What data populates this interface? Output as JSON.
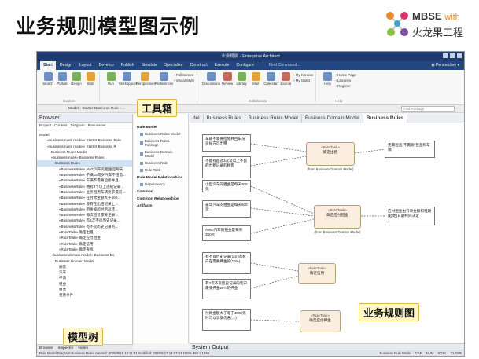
{
  "slide": {
    "title": "业务规则模型图示例",
    "logo_line1": "MBSE",
    "logo_with": "with",
    "logo_line2": "火龙果工程"
  },
  "window": {
    "title": "业务规则 - Enterprise Architect"
  },
  "menu": {
    "items": [
      "Start",
      "Design",
      "Layout",
      "Develop",
      "Publish",
      "Simulate",
      "Specialize",
      "Construct",
      "Execute",
      "Configure",
      "Find Command..."
    ],
    "active": "Start",
    "perspective": "Perspective"
  },
  "ribbon": {
    "groups": [
      {
        "label": "Explore",
        "buttons": [
          "Search",
          "Portals",
          "Design",
          "Start"
        ]
      },
      {
        "label": "Desktop",
        "buttons": [
          "Run",
          "Workspaces",
          "Perspectives",
          "Preferences"
        ],
        "small": [
          "Full Screen",
          "Visual Style"
        ]
      },
      {
        "label": "Collaborate",
        "buttons": [
          "Discussions",
          "Review",
          "Library",
          "Mail",
          "Calendar",
          "Journal"
        ],
        "small": [
          "My Kanban",
          "My Gantt"
        ]
      },
      {
        "label": "Help",
        "buttons": [
          "Help"
        ],
        "small": [
          "Home Page",
          "Libraries",
          "Register"
        ]
      }
    ]
  },
  "address": {
    "path": "Model  ›  Starter Business Rule  ›  ...",
    "find_placeholder": "Find Package"
  },
  "browser": {
    "title": "Browser",
    "tabs": [
      "Project",
      "Context",
      "Diagram",
      "Resources"
    ],
    "tree": [
      "Model",
      "«business rules model» Starter Business Rule",
      "«business rules model» Starter Business R",
      "Business Rules Model",
      "«business rules» Business Rules",
      "Business Rules",
      "«BusinessRule» AWD汽车的租金是每天...",
      "«BusinessRule» 不满18周岁汽车不租借...",
      "«BusinessRule» 车辆不需要检修并且...",
      "«BusinessRule» 拥有3个以上违规记录...",
      "«BusinessRule» 业务租用车辆要求提前...",
      "«BusinessRule» 在付款金额大于500...",
      "«BusinessRule» 没有在出租记录上...",
      "«BusinessRule» 租金被超时后返还...",
      "«BusinessRule» 每次租赁都要记录...",
      "«BusinessRule» 有2次不良历史记录...",
      "«BusinessRule» 有不良历史记录的...",
      "«RuleTask» 确定出租",
      "«RuleTask» 确定应付租金",
      "«RuleTask» 确定信用",
      "«RuleTask» 确定查找",
      "«business domain model» Business Do",
      "Business Domain Model",
      "顾客",
      "汽车",
      "申请",
      "租金",
      "租赁",
      "租赁条件"
    ],
    "bottom_tabs": [
      "Browser",
      "Inspector",
      "Notes"
    ]
  },
  "toolbox": {
    "sections": [
      {
        "title": "Rule Model",
        "items": [
          "Business Rules Model",
          "Business Rules Package",
          "Business Domain Model",
          "Business Rule",
          "Rule Task"
        ]
      },
      {
        "title": "Rule Model Relationships",
        "items": [
          "Dependency"
        ]
      },
      {
        "title": "Common",
        "items": []
      },
      {
        "title": "Common Relationships",
        "items": []
      },
      {
        "title": "Artifacts",
        "items": []
      }
    ]
  },
  "diagram": {
    "tabs": [
      "del",
      "Business Rules",
      "Business Rules Model",
      "Business Domain Model",
      "Business Rules"
    ],
    "active_tab": 4,
    "breadcrumb": "Business Rules    Rule Model Diagram",
    "notes": [
      "车辆不需要检修并且车况良好方可出租",
      "不能有超过3次及以上不良的出租记录的顾客",
      "小型汽车的租金是每天300元",
      "豪华汽车的租金是每天500元",
      "AWD汽车的租金是每天350元",
      "有不良历史记录(1次)的客户在需要押金的(10%)",
      "有2次不良历史记录的客户需要押金20%的押金",
      "付款金额大于等于4000元时可以享受优惠(…)",
      "无需检查(不需要)检查和车辆",
      "应付租金由订单金额和租期(起始)日期共同决定"
    ],
    "tasks": [
      {
        "stereo": "«RuleTask»",
        "name": "确定出租",
        "from": "(from Business Domain Model)"
      },
      {
        "stereo": "«RuleTask»",
        "name": "确定应付租金",
        "from": "(from Business Domain Model)"
      },
      {
        "stereo": "«RuleTask»",
        "name": "确定信用",
        "from": ""
      },
      {
        "stereo": "«RuleTask»",
        "name": "确定应付押金",
        "from": ""
      }
    ]
  },
  "callouts": {
    "toolbox": "工具箱",
    "model_tree": "模型树",
    "diagram": "业务规则图"
  },
  "system_output": {
    "label": "System Output"
  },
  "statusbar": {
    "left": "Rule Model Diagram:Business Rules   created: 2020/8/16 14:11:31  modified: 2020/9/17 14:07:04  100%  850 x 1098",
    "right": [
      "Business Rule Model",
      "CAP",
      "NUM",
      "SCRL",
      "CLOUD"
    ]
  }
}
